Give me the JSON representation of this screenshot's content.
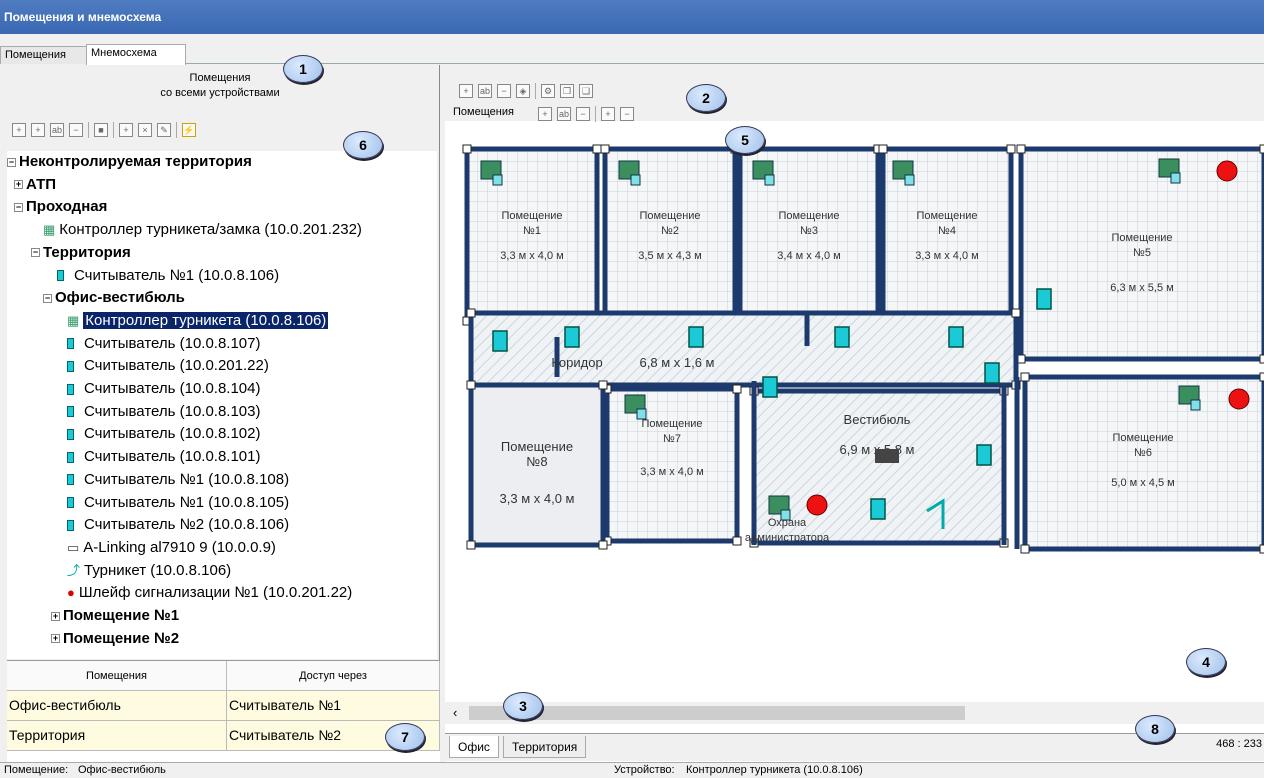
{
  "window": {
    "title": "Помещения и мнемосхема"
  },
  "tabs": [
    "Помещения",
    "Мнемосхема"
  ],
  "left_header": {
    "line1": "Помещения",
    "line2": "со всеми устройствами"
  },
  "tree": [
    {
      "label": "Неконтролируемая территория",
      "bold": true,
      "expander": "−"
    },
    {
      "label": "АТП",
      "bold": true,
      "expander": "+"
    },
    {
      "label": "Проходная",
      "bold": true,
      "expander": "−"
    },
    {
      "label": "Контроллер турникета/замка (10.0.201.232)",
      "icon": "controller-icon"
    },
    {
      "label": "Территория",
      "bold": true,
      "expander": "−"
    },
    {
      "label": "Считыватель №1 (10.0.8.106)",
      "icon": "reader-icon"
    },
    {
      "label": "Офис-вестибюль",
      "bold": true,
      "expander": "−"
    },
    {
      "label": "Контроллер турникета (10.0.8.106)",
      "icon": "controller-icon",
      "selected": true
    },
    {
      "label": "Считыватель (10.0.8.107)",
      "icon": "reader-icon"
    },
    {
      "label": "Считыватель (10.0.201.22)",
      "icon": "reader-icon"
    },
    {
      "label": "Считыватель (10.0.8.104)",
      "icon": "reader-icon"
    },
    {
      "label": "Считыватель (10.0.8.103)",
      "icon": "reader-icon"
    },
    {
      "label": "Считыватель (10.0.8.102)",
      "icon": "reader-icon"
    },
    {
      "label": "Считыватель (10.0.8.101)",
      "icon": "reader-icon"
    },
    {
      "label": "Считыватель №1 (10.0.8.108)",
      "icon": "reader-icon"
    },
    {
      "label": "Считыватель №1 (10.0.8.105)",
      "icon": "reader-icon"
    },
    {
      "label": "Считыватель №2 (10.0.8.106)",
      "icon": "reader-icon"
    },
    {
      "label": "A-Linking al7910 9 (10.0.0.9)",
      "icon": "camera-icon"
    },
    {
      "label": "Турникет (10.0.8.106)",
      "icon": "turnstile-icon"
    },
    {
      "label": "Шлейф сигнализации №1 (10.0.201.22)",
      "icon": "alarm-icon"
    },
    {
      "label": "Помещение №1",
      "bold": true,
      "expander": "+"
    },
    {
      "label": "Помещение №2",
      "bold": true,
      "expander": "+"
    }
  ],
  "access_table": {
    "headers": [
      "Помещения",
      "Доступ через"
    ],
    "rows": [
      [
        "Офис-вестибюль",
        "Считыватель №1"
      ],
      [
        "Территория",
        "Считыватель №2"
      ]
    ]
  },
  "map_toolbar": {
    "rooms_label": "Помещения"
  },
  "rooms": [
    {
      "name": "Помещение\n№1",
      "size": "3,3 м х 4,0 м"
    },
    {
      "name": "Помещение\n№2",
      "size": "3,5 м х 4,3 м"
    },
    {
      "name": "Помещение\n№3",
      "size": "3,4 м х 4,0 м"
    },
    {
      "name": "Помещение\n№4",
      "size": "3,3 м х 4,0 м"
    },
    {
      "name": "Помещение\n№5",
      "size": "6,3 м х 5,5 м"
    },
    {
      "name": "Коридор",
      "size": "6,8 м х 1,6 м"
    },
    {
      "name": "Вестибюль",
      "size": "6,9 м х 5,8 м"
    },
    {
      "name": "Помещение\n№6",
      "size": "5,0 м х 4,5 м"
    },
    {
      "name": "Помещение\n№7",
      "size": "3,3 м х 4,0 м"
    },
    {
      "name": "Помещение\n№8",
      "size": "3,3 м х 4,0 м"
    },
    {
      "name": "Охрана\nадминистратора",
      "size": ""
    }
  ],
  "bottom_tabs": [
    "Офис",
    "Территория"
  ],
  "coords": "468 : 233",
  "status": {
    "room_label": "Помещение:",
    "room_value": "Офис-вестибюль",
    "device_label": "Устройство:",
    "device_value": "Контроллер турникета (10.0.8.106)"
  },
  "callouts": [
    "1",
    "2",
    "3",
    "4",
    "5",
    "6",
    "7",
    "8"
  ],
  "colors": {
    "title_bar": "#3a68b3",
    "wall": "#1c3a6e",
    "reader": "#1cc9d6",
    "selection": "#0a246a"
  }
}
